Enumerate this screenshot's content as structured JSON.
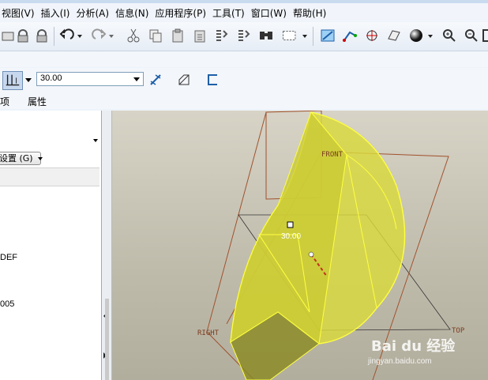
{
  "menubar": {
    "items": [
      {
        "label": "视图(V)"
      },
      {
        "label": "插入(I)"
      },
      {
        "label": "分析(A)"
      },
      {
        "label": "信息(N)"
      },
      {
        "label": "应用程序(P)"
      },
      {
        "label": "工具(T)"
      },
      {
        "label": "窗口(W)"
      },
      {
        "label": "帮助(H)"
      }
    ]
  },
  "dashboard": {
    "depth_value": "30.00"
  },
  "tabs": {
    "options_partial": "项",
    "properties": "属性"
  },
  "left_panel": {
    "settings_button": "设置 (G)",
    "tree_items": [
      {
        "label": "DEF"
      },
      {
        "label": "005"
      }
    ]
  },
  "viewport": {
    "dimension_label": "30.00",
    "plane_front": "FRONT",
    "plane_right": "RIGHT",
    "plane_top": "TOP",
    "colors": {
      "solid_fill": "#d9d93c",
      "solid_edge": "#ffff40",
      "datum_plane": "#a0522d",
      "background": "#cbc7b8"
    }
  },
  "watermark": {
    "text": "Bai du 经验",
    "url": "jingyan.baidu.com"
  }
}
